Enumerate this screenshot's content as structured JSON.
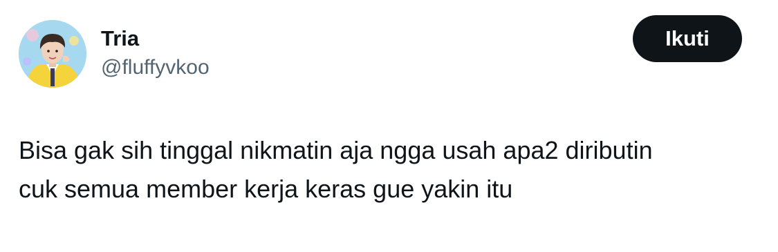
{
  "user": {
    "display_name": "Tria",
    "handle": "@fluffyvkoo"
  },
  "follow_button": {
    "label": "Ikuti"
  },
  "tweet": {
    "lines": [
      "Bisa gak sih tinggal nikmatin aja ngga usah apa2 diributin",
      "cuk semua member kerja keras gue yakin itu"
    ]
  },
  "colors": {
    "text_primary": "#0f1419",
    "text_secondary": "#536471",
    "button_bg": "#0f1419",
    "button_text": "#ffffff",
    "background": "#ffffff"
  }
}
